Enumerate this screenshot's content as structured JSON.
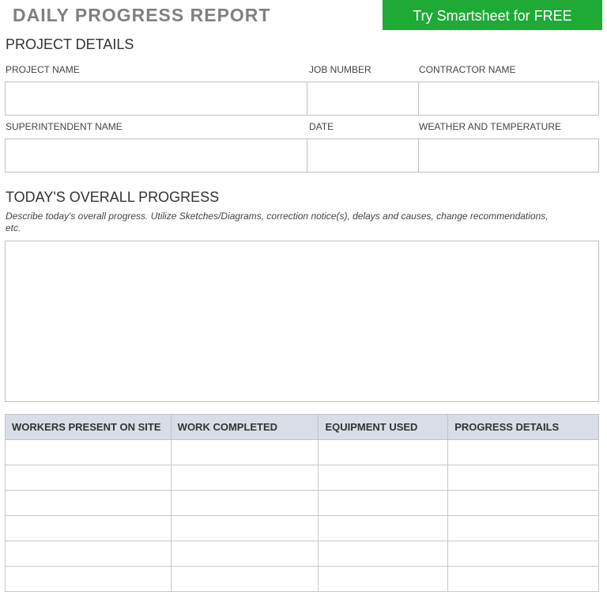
{
  "header": {
    "title": "DAILY PROGRESS REPORT",
    "cta_label": "Try Smartsheet for FREE",
    "cta_color": "#1faa35"
  },
  "project_details": {
    "heading": "PROJECT DETAILS",
    "labels": {
      "project_name": "PROJECT NAME",
      "job_number": "JOB NUMBER",
      "contractor_name": "CONTRACTOR NAME",
      "superintendent_name": "SUPERINTENDENT NAME",
      "date": "DATE",
      "weather": "WEATHER AND TEMPERATURE"
    }
  },
  "overall_progress": {
    "heading": "TODAY'S OVERALL PROGRESS",
    "instructions": "Describe today's overall progress.  Utilize Sketches/Diagrams, correction notice(s), delays and causes, change recommendations, etc."
  },
  "table": {
    "header_color": "#d9dde5",
    "columns": [
      "WORKERS PRESENT ON SITE",
      "WORK COMPLETED",
      "EQUIPMENT USED",
      "PROGRESS DETAILS"
    ],
    "visible_rows": 6
  }
}
